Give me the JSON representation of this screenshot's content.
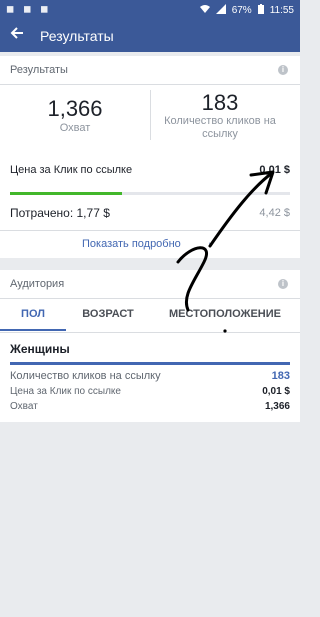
{
  "status_bar": {
    "battery": "67%",
    "time": "11:55"
  },
  "app_bar": {
    "back_icon": "arrow-left-icon",
    "title": "Результаты"
  },
  "results": {
    "header": "Результаты",
    "reach_value": "1,366",
    "reach_label": "Охват",
    "clicks_value": "183",
    "clicks_label_1": "Количество кликов на",
    "clicks_label_2": "ссылку",
    "cpc_label": "Цена за Клик по ссылке",
    "cpc_value": "0,01 $",
    "spent_label": "Потрачено: 1,77 $",
    "budget_value": "4,42 $",
    "spent_fraction": 0.4,
    "show_more": "Показать подробно"
  },
  "audience": {
    "header": "Аудитория",
    "tabs": [
      "ПОЛ",
      "ВОЗРАСТ",
      "МЕСТОПОЛОЖЕНИЕ"
    ],
    "active_tab_index": 0,
    "group_title": "Женщины",
    "rows": [
      {
        "label": "Количество кликов на ссылку",
        "value": "183"
      },
      {
        "label": "Цена за Клик по ссылке",
        "value": "0,01 $"
      },
      {
        "label": "Охват",
        "value": "1,366"
      }
    ]
  },
  "colors": {
    "header_bg": "#3b5998",
    "accent": "#4267b2",
    "progress": "#42b72a"
  }
}
